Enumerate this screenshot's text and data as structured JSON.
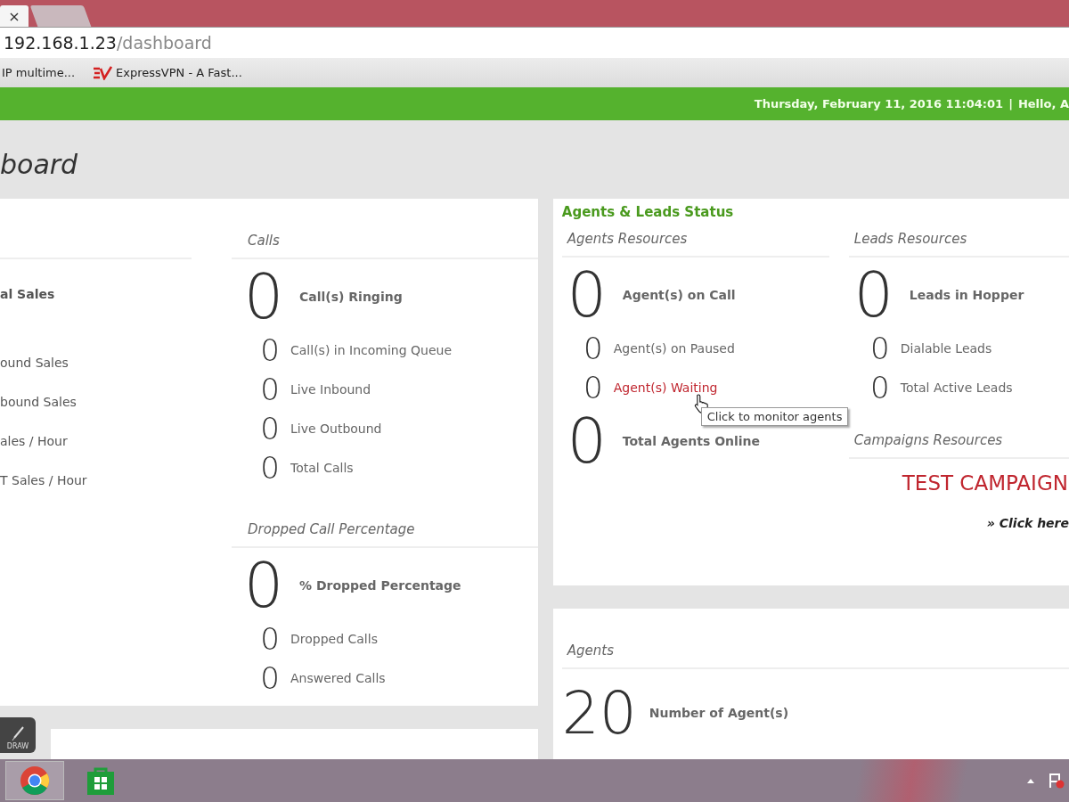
{
  "browser": {
    "tabs": [
      {
        "close": "×",
        "selected": true
      },
      {
        "selected": false
      }
    ],
    "url_host": "192.168.1.23",
    "url_path": "/dashboard",
    "bookmarks": [
      {
        "label": "IP multime..."
      },
      {
        "label": "ExpressVPN - A Fast..."
      }
    ]
  },
  "header": {
    "datetime": "Thursday, February 11, 2016 11:04:01",
    "separator": "|",
    "greeting": "Hello, A"
  },
  "page_title": "board",
  "sales": {
    "items": [
      {
        "label": "al Sales",
        "kind": "main"
      },
      {
        "label": "ound Sales",
        "kind": "sub"
      },
      {
        "label": "bound Sales",
        "kind": "sub"
      },
      {
        "label": "ales / Hour",
        "kind": "sub"
      },
      {
        "label": "T Sales / Hour",
        "kind": "sub"
      }
    ]
  },
  "calls": [
    {
      "title": "Calls",
      "items": [
        {
          "value": "0",
          "label": "Call(s) Ringing",
          "kind": "main"
        },
        {
          "value": "0",
          "label": "Call(s) in Incoming Queue",
          "kind": "sub"
        },
        {
          "value": "0",
          "label": "Live Inbound",
          "kind": "sub"
        },
        {
          "value": "0",
          "label": "Live Outbound",
          "kind": "sub"
        },
        {
          "value": "0",
          "label": "Total Calls",
          "kind": "sub"
        }
      ]
    },
    {
      "title": "Dropped Call Percentage",
      "items": [
        {
          "value": "0",
          "label": "% Dropped Percentage",
          "kind": "main"
        },
        {
          "value": "0",
          "label": "Dropped Calls",
          "kind": "sub"
        },
        {
          "value": "0",
          "label": "Answered Calls",
          "kind": "sub"
        }
      ]
    }
  ],
  "status": {
    "title": "Agents & Leads Status",
    "agents": {
      "title": "Agents Resources",
      "items": [
        {
          "value": "0",
          "label": "Agent(s) on Call",
          "kind": "main"
        },
        {
          "value": "0",
          "label": "Agent(s) on Paused",
          "kind": "sub"
        },
        {
          "value": "0",
          "label": "Agent(s) Waiting",
          "kind": "link"
        },
        {
          "value": "0",
          "label": "Total Agents Online",
          "kind": "main"
        }
      ],
      "tooltip": "Click to monitor agents"
    },
    "leads": {
      "title": "Leads Resources",
      "items": [
        {
          "value": "0",
          "label": "Leads in Hopper",
          "kind": "main"
        },
        {
          "value": "0",
          "label": "Dialable Leads",
          "kind": "sub"
        },
        {
          "value": "0",
          "label": "Total Active Leads",
          "kind": "sub"
        }
      ]
    },
    "campaigns": {
      "title": "Campaigns Resources",
      "name": "TEST CAMPAIGN",
      "link": "» Click here"
    }
  },
  "agents_card": {
    "title": "Agents",
    "value": "20",
    "label": "Number of Agent(s)"
  },
  "draw_widget": {
    "label": "DRAW"
  },
  "taskbar": {
    "apps": [
      {
        "selected": true,
        "kind": "chrome"
      },
      {
        "selected": false,
        "kind": "store"
      }
    ]
  }
}
